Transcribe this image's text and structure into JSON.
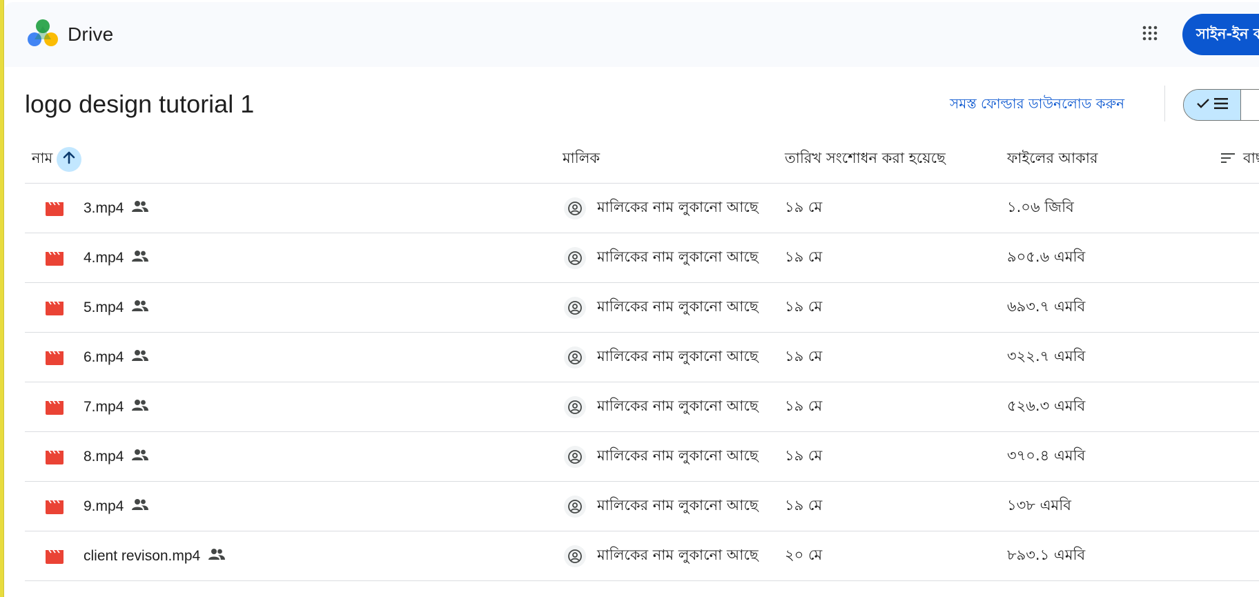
{
  "header": {
    "brand": "Drive",
    "signin_label": "সাইন-ইন করুন"
  },
  "folder": {
    "title": "logo design tutorial 1",
    "download_label": "সমস্ত ফোল্ডার ডাউনলোড করুন"
  },
  "columns": {
    "name": "নাম",
    "owner": "মালিক",
    "modified": "তারিখ সংশোধন করা হয়েছে",
    "size": "ফাইলের আকার",
    "sort": "বাছাই করুন"
  },
  "files": [
    {
      "name": "3.mp4",
      "owner": "মালিকের নাম লুকানো আছে",
      "modified": "১৯ মে",
      "size": "১.০৬ জিবি"
    },
    {
      "name": "4.mp4",
      "owner": "মালিকের নাম লুকানো আছে",
      "modified": "১৯ মে",
      "size": "৯০৫.৬ এমবি"
    },
    {
      "name": "5.mp4",
      "owner": "মালিকের নাম লুকানো আছে",
      "modified": "১৯ মে",
      "size": "৬৯৩.৭ এমবি"
    },
    {
      "name": "6.mp4",
      "owner": "মালিকের নাম লুকানো আছে",
      "modified": "১৯ মে",
      "size": "৩২২.৭ এমবি"
    },
    {
      "name": "7.mp4",
      "owner": "মালিকের নাম লুকানো আছে",
      "modified": "১৯ মে",
      "size": "৫২৬.৩ এমবি"
    },
    {
      "name": "8.mp4",
      "owner": "মালিকের নাম লুকানো আছে",
      "modified": "১৯ মে",
      "size": "৩৭০.৪ এমবি"
    },
    {
      "name": "9.mp4",
      "owner": "মালিকের নাম লুকানো আছে",
      "modified": "১৯ মে",
      "size": "১৩৮ এমবি"
    },
    {
      "name": "client revison.mp4",
      "owner": "মালিকের নাম লুকানো আছে",
      "modified": "২০ মে",
      "size": "৮৯৩.১ এমবি"
    }
  ],
  "icons": {
    "file_type": "video-file-icon",
    "shared": "shared-people-icon",
    "owner": "account-circle-icon",
    "apps": "apps-grid-icon",
    "sort_direction": "arrow-up-icon"
  },
  "colors": {
    "accent": "#0b57d0",
    "selected_bg": "#c2e7ff",
    "video_icon": "#ea4335",
    "header_bg": "#f8fafd",
    "divider": "#dadce0"
  }
}
